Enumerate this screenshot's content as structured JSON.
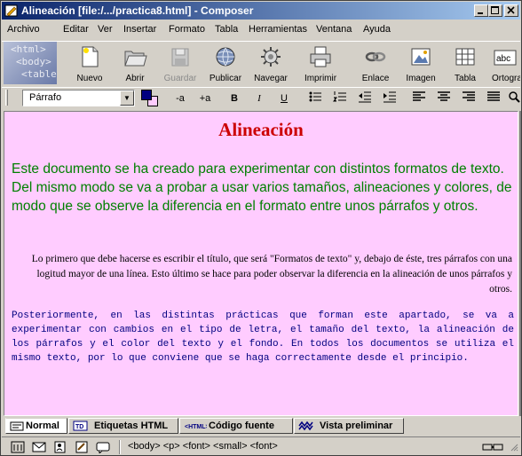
{
  "window": {
    "title": "Alineación [file:/.../practica8.html] - Composer"
  },
  "menu": {
    "items": [
      "Archivo",
      "Editar",
      "Ver",
      "Insertar",
      "Formato",
      "Tabla",
      "Herramientas",
      "Ventana",
      "Ayuda"
    ]
  },
  "logo": {
    "line1": "<html>",
    "line2": "<body>",
    "line3": "<table"
  },
  "toolbar": {
    "buttons": [
      {
        "label": "Nuevo",
        "icon": "new-page-icon",
        "enabled": true
      },
      {
        "label": "Abrir",
        "icon": "folder-open-icon",
        "enabled": true
      },
      {
        "label": "Guardar",
        "icon": "save-disk-icon",
        "enabled": false
      },
      {
        "label": "Publicar",
        "icon": "globe-publish-icon",
        "enabled": true
      },
      {
        "label": "Navegar",
        "icon": "browse-gear-icon",
        "enabled": true
      },
      {
        "label": "Imprimir",
        "icon": "printer-icon",
        "enabled": true
      },
      {
        "label": "Enlace",
        "icon": "link-chain-icon",
        "enabled": true
      },
      {
        "label": "Imagen",
        "icon": "image-icon",
        "enabled": true
      },
      {
        "label": "Tabla",
        "icon": "table-icon",
        "enabled": true
      },
      {
        "label": "Ortogra",
        "icon": "spellcheck-icon",
        "enabled": true
      }
    ]
  },
  "format": {
    "paragraph_style": "Párrafo",
    "text_color": "#000080",
    "background_color": "#ffccff",
    "smaller": "-a",
    "larger": "+a",
    "bold": "B",
    "italic": "I",
    "underline": "U"
  },
  "document": {
    "heading": "Alineación",
    "heading_color": "#cc0000",
    "p1": "Este documento se ha creado para experimentar con distintos formatos de texto. Del mismo modo se va a probar a usar varios tamaños, alineaciones y colores, de modo que se observe la diferencia en el formato entre unos párrafos y otros.",
    "p1_color": "#008000",
    "p2": "Lo primero que debe hacerse es escribir el título, que será \"Formatos de texto\" y, debajo de éste, tres párrafos con una logitud mayor de una línea. Esto último se hace para poder observar la diferencia en la alineación de unos párrafos y otros.",
    "p3": "Posteriormente, en las distintas prácticas que forman este apartado, se va a experimentar con cambios en el tipo de letra, el tamaño del texto, la alineación de los párrafos y el color del texto y el fondo. En todos los documentos se utiliza el mismo texto, por lo que conviene que se haga correctamente desde el principio.",
    "p3_color": "#000080",
    "page_background": "#ffccff"
  },
  "tabs": {
    "normal": "Normal",
    "tags": "Etiquetas HTML",
    "source": "Código fuente",
    "preview": "Vista preliminar"
  },
  "status": {
    "tag_path": "<body> <p> <font> <small> <font>"
  }
}
